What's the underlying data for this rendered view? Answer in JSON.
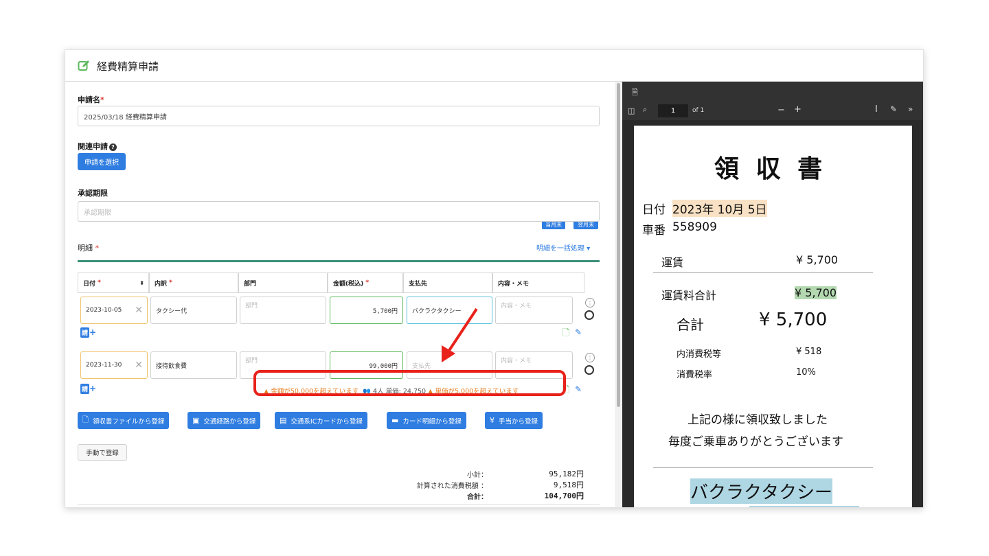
{
  "header": {
    "title": "経費精算申請",
    "icon": "edit-icon"
  },
  "form": {
    "name_label": "申請名",
    "name_value": "2025/03/18 経費精算申請",
    "related_label": "関連申請",
    "related_button": "申請を選択",
    "deadline_label": "承認期限",
    "deadline_placeholder": "承認期限",
    "tag_this_month": "当月末",
    "tag_next_month": "翌月末",
    "details_label": "明細",
    "bulk_action": "明細を一括処理 ▾",
    "columns": [
      "日付",
      "内訳",
      "部門",
      "金額(税込)",
      "支払先",
      "内容・メモ"
    ],
    "rows": [
      {
        "date": "2023-10-05",
        "item": "タクシー代",
        "dept_placeholder": "部門",
        "amount": "5,700円",
        "payee": "バクラクタクシー",
        "memo_placeholder": "内容・メモ"
      },
      {
        "date": "2023-11-30",
        "item": "接待飲食費",
        "dept_placeholder": "部門",
        "amount": "99,000円",
        "payee_placeholder": "支払先",
        "memo_placeholder": "内容・メモ"
      }
    ],
    "invoice_mark": "請",
    "warning": {
      "amount_over": "金額が50,000を超えています",
      "persons": "4人",
      "unit_price": "単価: 24,750",
      "unit_over": "単価が5,000を超えています"
    },
    "register_buttons": [
      {
        "icon": "file-icon",
        "label": "領収書ファイルから登録"
      },
      {
        "icon": "train-icon",
        "label": "交通経路から登録"
      },
      {
        "icon": "ic-card-icon",
        "label": "交通系ICカードから登録"
      },
      {
        "icon": "credit-card-icon",
        "label": "カード明細から登録"
      },
      {
        "icon": "yen-icon",
        "label": "手当から登録"
      }
    ],
    "manual_button": "手動で登録",
    "summary": {
      "subtotal_label": "小計：",
      "subtotal_value": "95,182円",
      "tax_label": "計算された消費税額 ：",
      "tax_value": "9,518円",
      "total_label": "合計：",
      "total_value": "104,700円"
    }
  },
  "pdf": {
    "page_number": "1",
    "page_of": "of 1",
    "zoom_minus": "−",
    "zoom_plus": "+",
    "receipt": {
      "title": "領 収 書",
      "date_label": "日付",
      "date_value": "2023年 10月 5日",
      "car_label": "車番",
      "car_value": "558909",
      "fare_label": "運賃",
      "fare_value": "¥ 5,700",
      "fare_total_label": "運賃料合計",
      "fare_total_value": "¥ 5,700",
      "total_label": "合計",
      "total_value": "¥ 5,700",
      "tax_label": "内消費税等",
      "tax_value": "¥ 518",
      "tax_rate_label": "消費税率",
      "tax_rate_value": "10%",
      "thanks_1": "上記の様に領収致しました",
      "thanks_2": "毎度ご乗車ありがとうございます",
      "company": "バクラクタクシー"
    }
  },
  "colors": {
    "primary": "#2f7de1",
    "warning": "#e67e22",
    "highlight_red": "#e8221b"
  }
}
